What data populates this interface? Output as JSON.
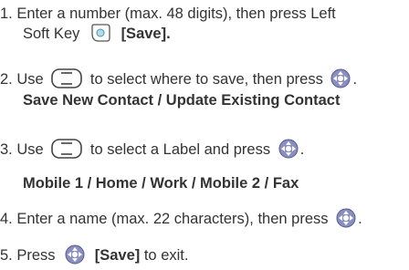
{
  "steps": {
    "s1": {
      "line1": "1. Enter a number (max. 48 digits), then press Left",
      "line2_pre": "Soft Key",
      "line2_post": "[Save]."
    },
    "s2": {
      "pre": "2. Use",
      "mid": "to select where to save, then press",
      "post": ".",
      "options": "Save New Contact / Update Existing Contact"
    },
    "s3": {
      "pre": "3. Use",
      "mid": "to select a Label and press",
      "post": ".",
      "options": "Mobile 1 / Home / Work / Mobile 2 / Fax"
    },
    "s4": {
      "pre": "4. Enter a name (max. 22 characters), then press",
      "post": "."
    },
    "s5": {
      "pre": "5. Press",
      "save": "[Save]",
      "post": "to exit."
    }
  },
  "icons": {
    "soft_key": "left-soft-key-icon",
    "nav_key": "navigation-key-icon",
    "ok_key": "ok-key-icon"
  }
}
